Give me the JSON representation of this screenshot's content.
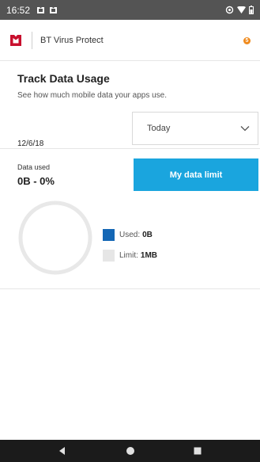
{
  "status_bar": {
    "time": "16:52",
    "icons": [
      "shield-notification-icon",
      "shield-notification-icon",
      "sync-icon",
      "wifi-icon",
      "battery-icon"
    ]
  },
  "app_bar": {
    "logo": "mcafee-shield-logo",
    "title": "BT Virus Protect",
    "notification_count": "5",
    "brand_color": "#c8102e",
    "badge_color": "#f08a1c"
  },
  "main": {
    "heading": "Track Data Usage",
    "subheading": "See how much mobile data your apps use.",
    "date": "12/6/18",
    "range_select": {
      "selected": "Today",
      "icon": "chevron-down-icon"
    },
    "data_used": {
      "label": "Data used",
      "value": "0B - 0%",
      "percent": 0
    },
    "limit_button": {
      "label": "My data limit",
      "color": "#1aa5de"
    },
    "legend": {
      "used_label": "Used:",
      "used_value": "0B",
      "used_color": "#1467b5",
      "limit_label": "Limit:",
      "limit_value": "1MB",
      "limit_color": "#e6e6e6"
    }
  },
  "nav_bar": {
    "buttons": [
      "back-icon",
      "home-icon",
      "recent-apps-icon"
    ]
  }
}
